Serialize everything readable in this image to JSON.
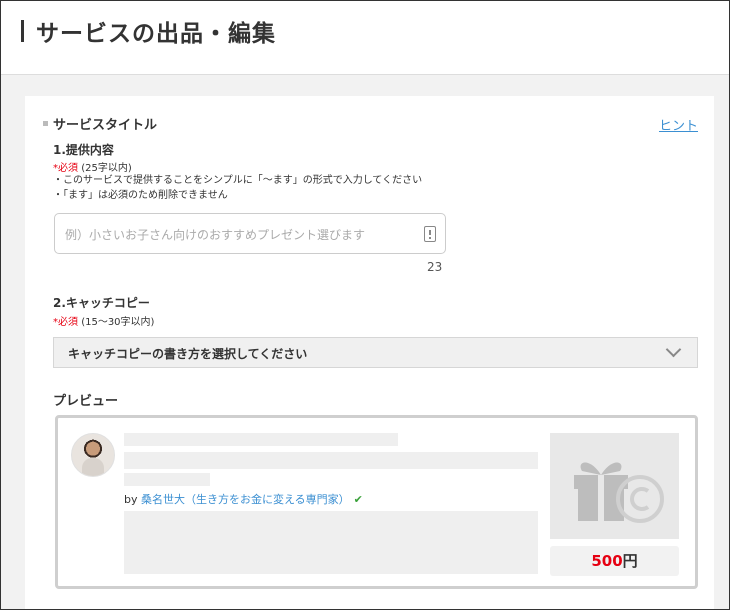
{
  "header": {
    "title": "サービスの出品・編集"
  },
  "section": {
    "title": "サービスタイトル",
    "hint_label": "ヒント"
  },
  "field1": {
    "label": "1.提供内容",
    "required_mark": "*必須",
    "required_note": "(25字以内)",
    "notes": [
      "・このサービスで提供することをシンプルに「～ます」の形式で入力してください",
      "・「ます」は必須のため削除できません"
    ],
    "placeholder": "例）小さいお子さん向けのおすすめプレゼント選びます",
    "counter": "23"
  },
  "field2": {
    "label": "2.キャッチコピー",
    "required_mark": "*必須",
    "required_note": "(15～30字以内)",
    "select_value": "キャッチコピーの書き方を選択してください"
  },
  "preview": {
    "label": "プレビュー",
    "by": "by",
    "author": "桑名世大（生き方をお金に変える専門家）",
    "verified_icon": "check-icon",
    "price_value": "500",
    "price_unit": "円"
  },
  "colors": {
    "required": "#e60012",
    "link": "#3b8fd2",
    "verified": "#3aa13a",
    "price": "#e60012"
  }
}
